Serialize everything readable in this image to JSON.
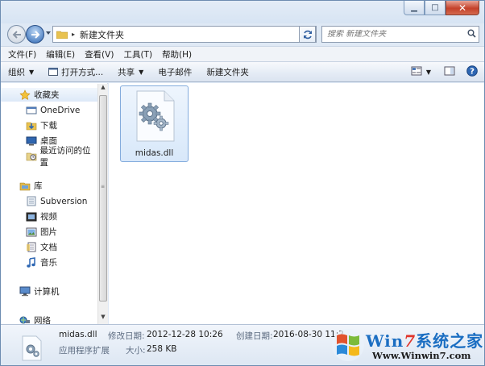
{
  "window": {
    "caption_buttons": {
      "minimize": "▁",
      "maximize": "□",
      "close": "✕"
    }
  },
  "address": {
    "path_sep": "▸",
    "path": "新建文件夹",
    "search_placeholder": "搜索 新建文件夹"
  },
  "menu": [
    "文件(F)",
    "编辑(E)",
    "查看(V)",
    "工具(T)",
    "帮助(H)"
  ],
  "commands": {
    "organize": "组织",
    "open_with": "打开方式...",
    "share": "共享",
    "email": "电子邮件",
    "new_folder": "新建文件夹"
  },
  "sidebar": {
    "favorites": {
      "label": "收藏夹",
      "items": [
        "OneDrive",
        "下载",
        "桌面",
        "最近访问的位置"
      ]
    },
    "libraries": {
      "label": "库",
      "items": [
        "Subversion",
        "视频",
        "图片",
        "文档",
        "音乐"
      ]
    },
    "computer": "计算机",
    "network": "网络"
  },
  "files": [
    {
      "name": "midas.dll",
      "icon": "dll-gear-icon"
    }
  ],
  "details": {
    "name": "midas.dll",
    "type": "应用程序扩展",
    "modified_label": "修改日期:",
    "modified_value": "2012-12-28 10:26",
    "size_label": "大小:",
    "size_value": "258 KB",
    "created_label": "创建日期:",
    "created_value": "2016-08-30 11:2"
  },
  "watermark": {
    "title_win": "Win",
    "title_seven": "7",
    "title_rest": "系统之家",
    "url": "Www.Winwin7.com"
  },
  "colors": {
    "accent": "#2d66b3",
    "selection": "#84acdd",
    "close_red": "#c4412a"
  }
}
